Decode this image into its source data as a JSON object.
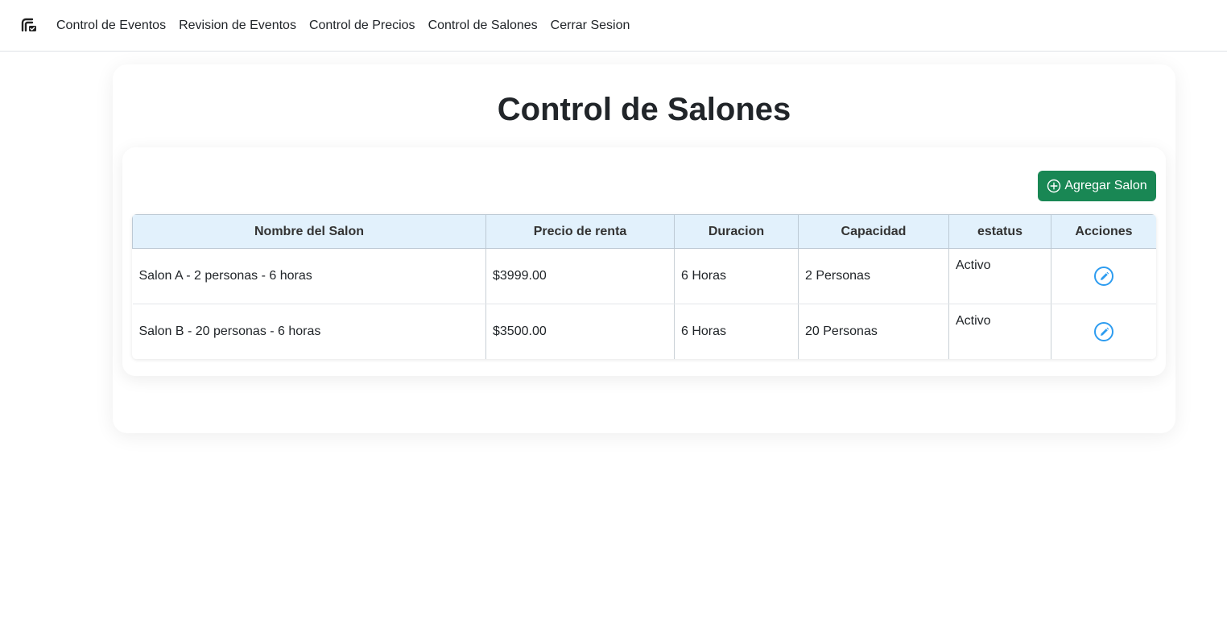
{
  "nav": {
    "brand_icon": "calendar-check-logo-icon",
    "links": [
      "Control de Eventos",
      "Revision de Eventos",
      "Control de Precios",
      "Control de Salones",
      "Cerrar Sesion"
    ]
  },
  "page": {
    "title": "Control de Salones"
  },
  "toolbar": {
    "add_label": "Agregar Salon",
    "add_icon": "plus-circle-icon",
    "add_color": "#198754"
  },
  "table": {
    "columns": [
      "Nombre del Salon",
      "Precio de renta",
      "Duracion",
      "Capacidad",
      "estatus",
      "Acciones"
    ],
    "rows": [
      {
        "nombre": "Salon A - 2 personas - 6 horas",
        "precio": "$3999.00",
        "duracion": "6 Horas",
        "capacidad": "2 Personas",
        "estatus": "Activo",
        "action_icon": "pencil-icon"
      },
      {
        "nombre": "Salon B - 20 personas - 6 horas",
        "precio": "$3500.00",
        "duracion": "6 Horas",
        "capacidad": "20 Personas",
        "estatus": "Activo",
        "action_icon": "pencil-icon"
      }
    ],
    "header_bg": "#e2f1fc",
    "action_color": "#2d9cf0"
  }
}
